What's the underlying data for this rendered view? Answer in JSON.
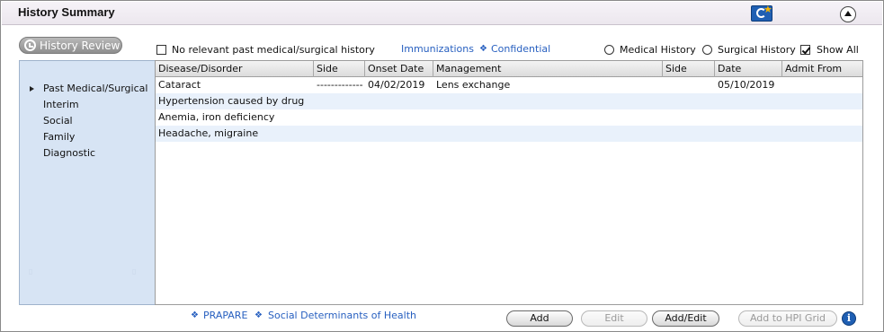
{
  "header": {
    "title": "History Summary",
    "app_icon": "c-star-app-icon",
    "collapse_icon": "collapse-up-icon"
  },
  "toolbar": {
    "history_review_label": "History Review",
    "no_relevant_label": "No relevant past medical/surgical history",
    "no_relevant_checked": false,
    "immunizations_label": "Immunizations",
    "confidential_label": "Confidential",
    "medical_history_label": "Medical History",
    "surgical_history_label": "Surgical History",
    "show_all_label": "Show All",
    "show_all_checked": true
  },
  "sidebar": {
    "items": [
      {
        "label": "Past Medical/Surgical",
        "selected": true
      },
      {
        "label": "Interim"
      },
      {
        "label": "Social"
      },
      {
        "label": "Family"
      },
      {
        "label": "Diagnostic"
      }
    ]
  },
  "grid": {
    "columns": [
      "Disease/Disorder",
      "Side",
      "Onset Date",
      "Management",
      "Side",
      "Date",
      "Admit From"
    ],
    "rows": [
      {
        "disease": "Cataract",
        "side": "------------------",
        "onset": "04/02/2019",
        "management": "Lens exchange",
        "side2": "",
        "date": "05/10/2019",
        "admit": ""
      },
      {
        "disease": "Hypertension caused by drug",
        "side": "",
        "onset": "",
        "management": "",
        "side2": "",
        "date": "",
        "admit": ""
      },
      {
        "disease": "Anemia, iron deficiency",
        "side": "",
        "onset": "",
        "management": "",
        "side2": "",
        "date": "",
        "admit": ""
      },
      {
        "disease": "Headache, migraine",
        "side": "",
        "onset": "",
        "management": "",
        "side2": "",
        "date": "",
        "admit": ""
      }
    ]
  },
  "footer": {
    "prapare_label": "PRAPARE",
    "sdoh_label": "Social Determinants of Health",
    "add_label": "Add",
    "edit_label": "Edit",
    "add_edit_label": "Add/Edit",
    "add_hpi_label": "Add to HPI Grid",
    "info_glyph": "i"
  }
}
